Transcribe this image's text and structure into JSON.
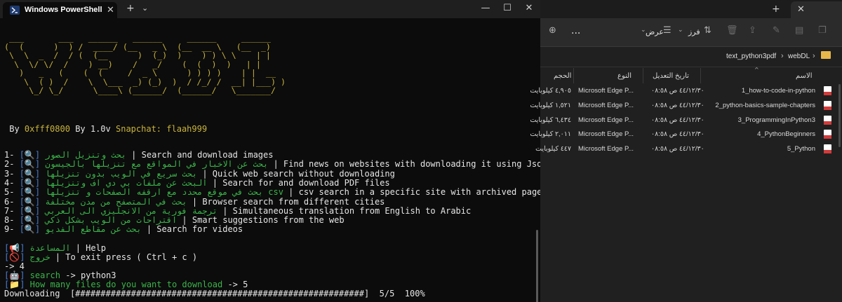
{
  "terminal": {
    "tab_title": "Windows PowerShell",
    "ascii_art": " ___       ___   ______   ______     ______     ______\n(  (      )  ) /  ____/ (__   _ \\  (__  __ \\   (__  _)\n \\  \\  _  /  / (  (__      )  (_)  )    ) ) \\ \\    | |\n  \\  \\/ \\/  /    ) __)    /   _/    (  (  )  )   | |\n   )   _   (    (  (     /  _ \\      ) ) ) )    | |  __\n    \\  ( )  /    \\  \\___  _) (_)  )  / /_/ /  __| |___) )\n     \\_/ \\_/      \\____\\ (______/  (______/   \\_______/",
    "credit": {
      "by": "By",
      "author": "0xfff0800",
      "by_version": "By 1.0v",
      "snap_label": "Snapchat:",
      "snap_handle": "flaah999"
    },
    "menu": [
      {
        "num": "1-",
        "ar": "بحث وتنزيل الصور",
        "en": "| Search and download images"
      },
      {
        "num": "2-",
        "ar": "بحث عن الاخبار في المواقع مع تنزيلها بالجيسون",
        "en": "| Find news on websites with downloading it using Json"
      },
      {
        "num": "3-",
        "ar": "بحث سريع في الويب بدون تنزيلها",
        "en": "| Quick web search without downloading"
      },
      {
        "num": "4-",
        "ar": "البحث عن ملفات بي دي اف وتنزيلها",
        "en": "| Search for and download PDF files"
      },
      {
        "num": "5-",
        "ar": "بحث في موقع محدد مع ارقفه الصفحات و تنزيلها csv",
        "en": "| csv search in a specific site with archived pages and download"
      },
      {
        "num": "6-",
        "ar": "بحث في المتصفح من مدن مختلفة",
        "en": "| Browser search from different cities"
      },
      {
        "num": "7-",
        "ar": "ترجمة فورية من الانجليزي الى العربي",
        "en": "| Simultaneous translation from English to Arabic"
      },
      {
        "num": "8-",
        "ar": "اقتراحات من الويب بشكل ذكي",
        "en": "| Smart suggestions from the web"
      },
      {
        "num": "9-",
        "ar": "بحث عن مقاطع الفديو",
        "en": "| Search for videos"
      }
    ],
    "help": {
      "ar": "المساعدة",
      "en": "| Help"
    },
    "exit": {
      "ar": "خروج",
      "en": "| To exit press ( Ctrl + c )"
    },
    "prompt_choice": "-> 4",
    "search": {
      "label": "search",
      "arrow": "->",
      "value": "python3"
    },
    "how_many": {
      "label": "How many files do you want to download",
      "arrow": "->",
      "value": "5"
    },
    "progress": {
      "label": "Downloading",
      "bar": "[#########################################################]",
      "count": "5/5",
      "percent": "100%",
      "fraction": 1.0
    }
  },
  "explorer": {
    "toolbar": {
      "more": "...",
      "view_label": "عرض",
      "sort_label": "فرز"
    },
    "breadcrumb": {
      "parent": "webDL",
      "current": "text_python3pdf",
      "sep": "›"
    },
    "columns": {
      "name": "الاسم",
      "modified": "تاريخ التعديل",
      "type": "النوع",
      "size": "الحجم"
    },
    "files": [
      {
        "name": "1_how-to-code-in-python",
        "modified": "٤٤/١٢/٣٠ ص ٠٨:٥٨",
        "type": "Microsoft Edge P...",
        "size": "٤,٩٠٥ كيلوبايت"
      },
      {
        "name": "2_python-basics-sample-chapters",
        "modified": "٤٤/١٢/٣٠ ص ٠٨:٥٨",
        "type": "Microsoft Edge P...",
        "size": "١,٥٢١ كيلوبايت"
      },
      {
        "name": "3_ProgrammingInPython3",
        "modified": "٤٤/١٢/٣٠ ص ٠٨:٥٨",
        "type": "Microsoft Edge P...",
        "size": "٦,٤٣٤ كيلوبايت"
      },
      {
        "name": "4_PythonBeginners",
        "modified": "٤٤/١٢/٣٠ ص ٠٨:٥٨",
        "type": "Microsoft Edge P...",
        "size": "٢,٠١١ كيلوبايت"
      },
      {
        "name": "5_Python",
        "modified": "٤٤/١٢/٣٠ ص ٠٨:٥٨",
        "type": "Microsoft Edge P...",
        "size": "٤٤٧ كيلوبايت"
      }
    ]
  }
}
